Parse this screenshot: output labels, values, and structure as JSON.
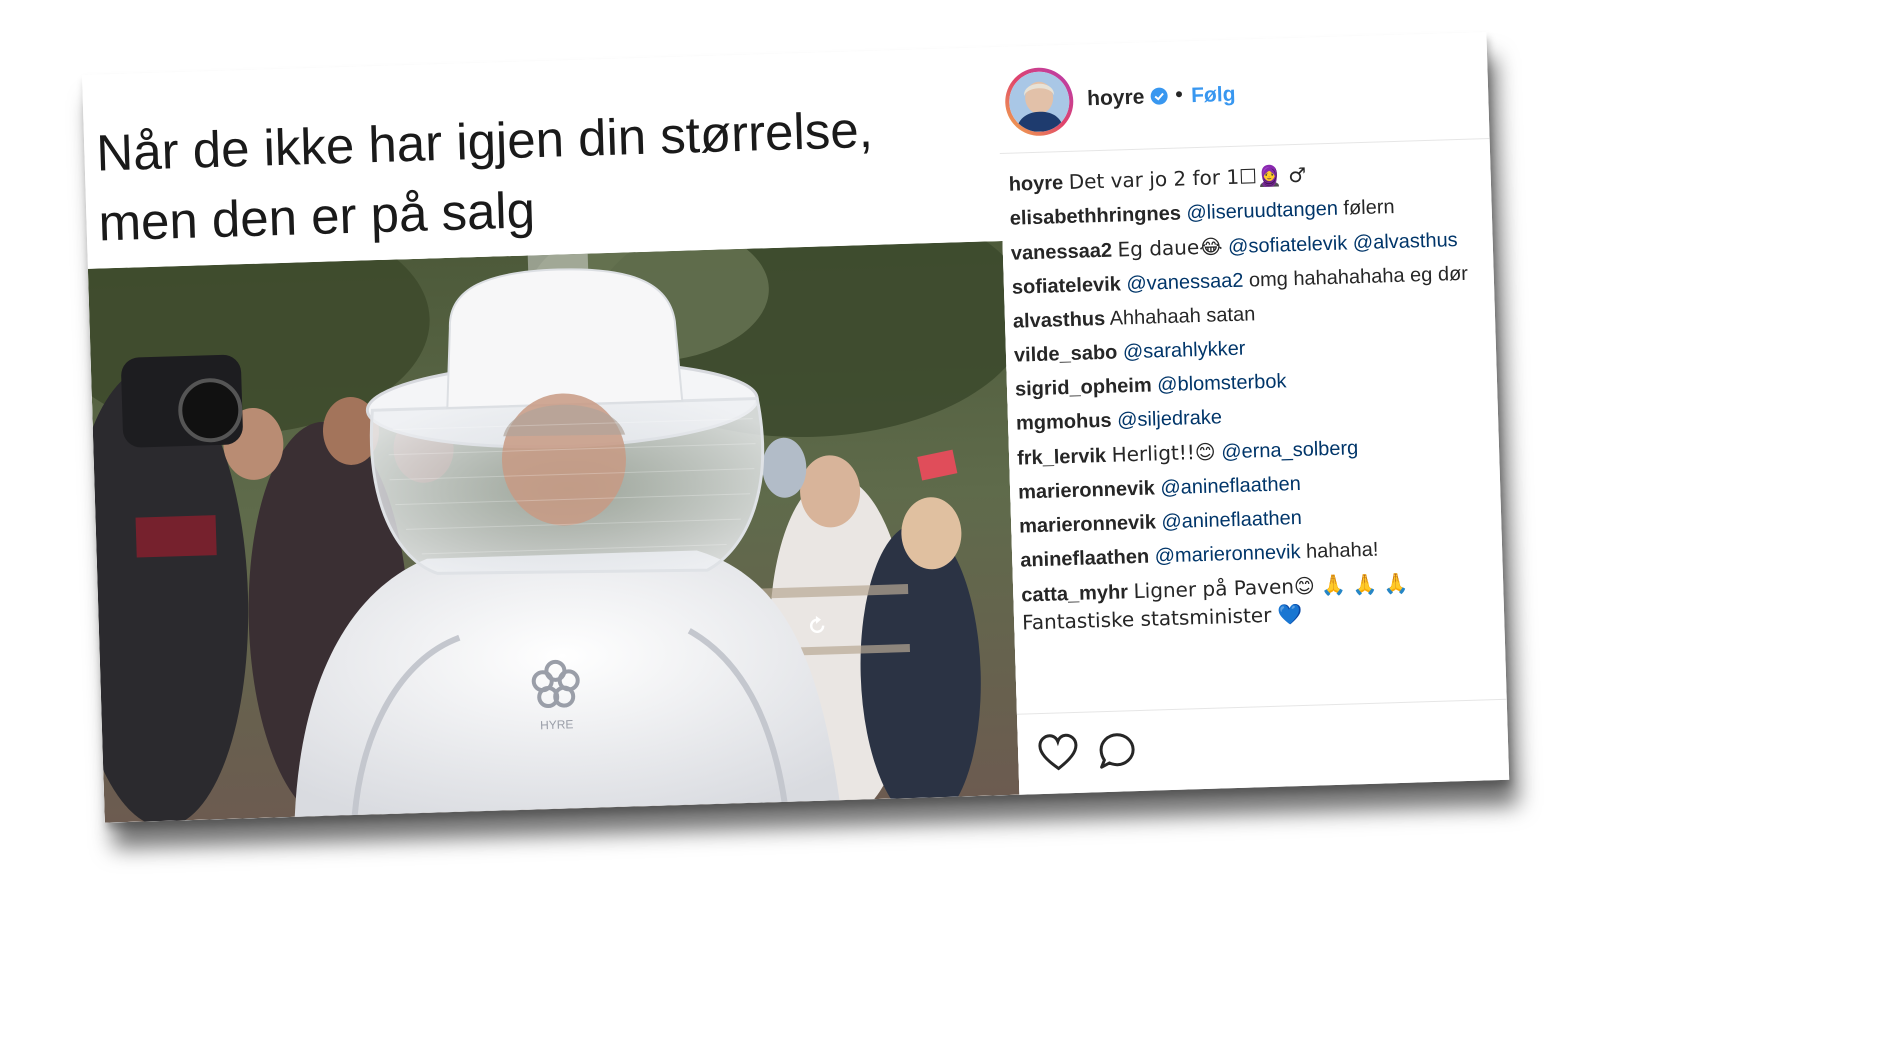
{
  "meme": {
    "caption_line1": "Når de ikke har igjen din størrelse,",
    "caption_line2": "men den er på salg",
    "photo_badge_text": "HYRE"
  },
  "post": {
    "username": "hoyre",
    "separator": "•",
    "follow_label": "Følg",
    "verified_icon": "verified-badge-icon",
    "caption": {
      "user": "hoyre",
      "text": "Det var jo 2 for 1☐🧕 ♂"
    },
    "comments": [
      {
        "user": "elisabethhringnes",
        "mention": "@liseruudtangen",
        "text": "følern"
      },
      {
        "user": "vanessaa2",
        "text_before": "Eg daue😂",
        "mention": "@sofiatelevik",
        "mention2": "@alvasthus"
      },
      {
        "user": "sofiatelevik",
        "mention": "@vanessaa2",
        "text": "omg hahahahaha eg dør"
      },
      {
        "user": "alvasthus",
        "text": "Ahhahaah satan"
      },
      {
        "user": "vilde_sabo",
        "mention": "@sarahlykker"
      },
      {
        "user": "sigrid_opheim",
        "mention": "@blomsterbok"
      },
      {
        "user": "mgmohus",
        "mention": "@siljedrake"
      },
      {
        "user": "frk_lervik",
        "text_before": "Herligt!!😊",
        "mention": "@erna_solberg"
      },
      {
        "user": "marieronnevik",
        "mention": "@anineflaathen"
      },
      {
        "user": "marieronnevik",
        "mention": "@anineflaathen"
      },
      {
        "user": "anineflaathen",
        "mention": "@marieronnevik",
        "text": "hahaha!"
      },
      {
        "user": "catta_myhr",
        "text": "Ligner på Paven😊 🙏 🙏 🙏 Fantastiske statsminister 💙"
      }
    ],
    "actions": {
      "like_icon": "heart-icon",
      "comment_icon": "comment-bubble-icon"
    }
  },
  "colors": {
    "follow_blue": "#3897f0",
    "mention_blue": "#003569",
    "text_dark": "#262626"
  }
}
